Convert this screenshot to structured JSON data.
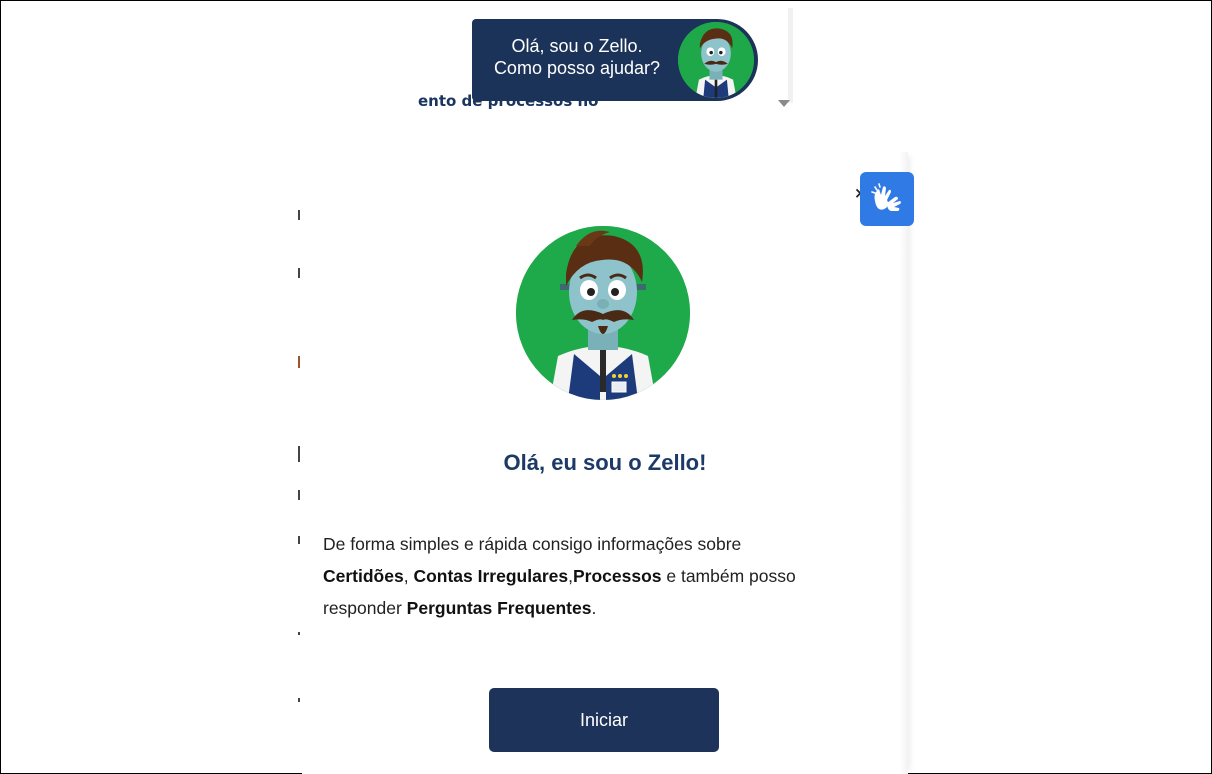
{
  "background": {
    "heading_fragment": "ento de processos no"
  },
  "bubble": {
    "line1": "Olá, sou o Zello.",
    "line2": "Como posso ajudar?"
  },
  "panel": {
    "title": "Olá, eu sou o Zello!",
    "desc_intro": "De forma simples e rápida consigo informações sobre",
    "topic1": "Certidões",
    "sep1": ", ",
    "topic2": "Contas Irregulares",
    "sep2": ",",
    "topic3": "Processos",
    "desc_mid": " e também posso",
    "desc_tail": "responder ",
    "topic4": "Perguntas Frequentes",
    "desc_end": ".",
    "start_label": "Iniciar",
    "close_glyph": "×"
  },
  "icons": {
    "avatar": "zello-mascot-icon",
    "accessibility": "sign-language-hands-icon",
    "dropdown": "caret-down-icon"
  },
  "colors": {
    "navy": "#1c3359",
    "title_blue": "#1d3a66",
    "mascot_green": "#1fa84a",
    "accessibility_blue": "#2f7ae5"
  }
}
